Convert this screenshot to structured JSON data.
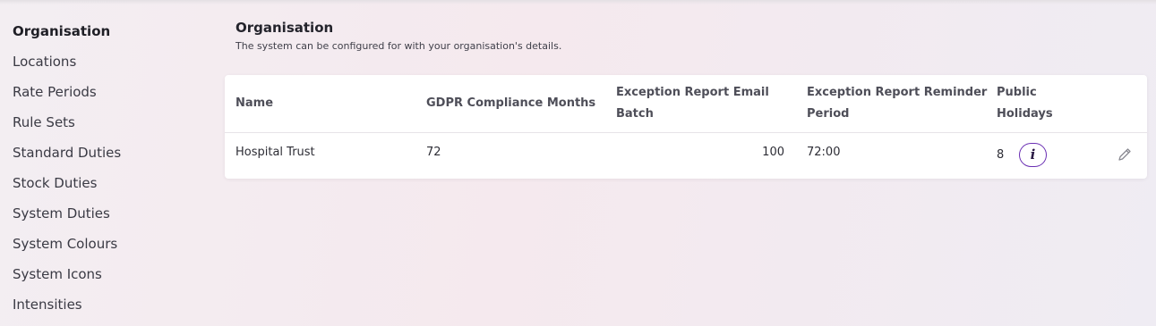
{
  "sidebar": {
    "items": [
      {
        "label": "Organisation",
        "active": true
      },
      {
        "label": "Locations"
      },
      {
        "label": "Rate Periods"
      },
      {
        "label": "Rule Sets"
      },
      {
        "label": "Standard Duties"
      },
      {
        "label": "Stock Duties"
      },
      {
        "label": "System Duties"
      },
      {
        "label": "System Colours"
      },
      {
        "label": "System Icons"
      },
      {
        "label": "Intensities"
      }
    ]
  },
  "main": {
    "title": "Organisation",
    "subtitle": "The system can be configured for with your organisation's details."
  },
  "table": {
    "columns": {
      "name": "Name",
      "gdpr": "GDPR Compliance Months",
      "email_batch_1": "Exception Report Email",
      "email_batch_2": "Batch",
      "reminder_1": "Exception Report Reminder",
      "reminder_2": "Period",
      "holidays_1": "Public",
      "holidays_2": "Holidays"
    },
    "row": {
      "name": "Hospital Trust",
      "gdpr": "72",
      "email_batch": "100",
      "reminder": "72:00",
      "holidays": "8"
    },
    "info_glyph": "i",
    "icons": {
      "info": "info-icon",
      "edit": "pencil-icon"
    }
  },
  "colors": {
    "accent": "#6a2fb3"
  }
}
